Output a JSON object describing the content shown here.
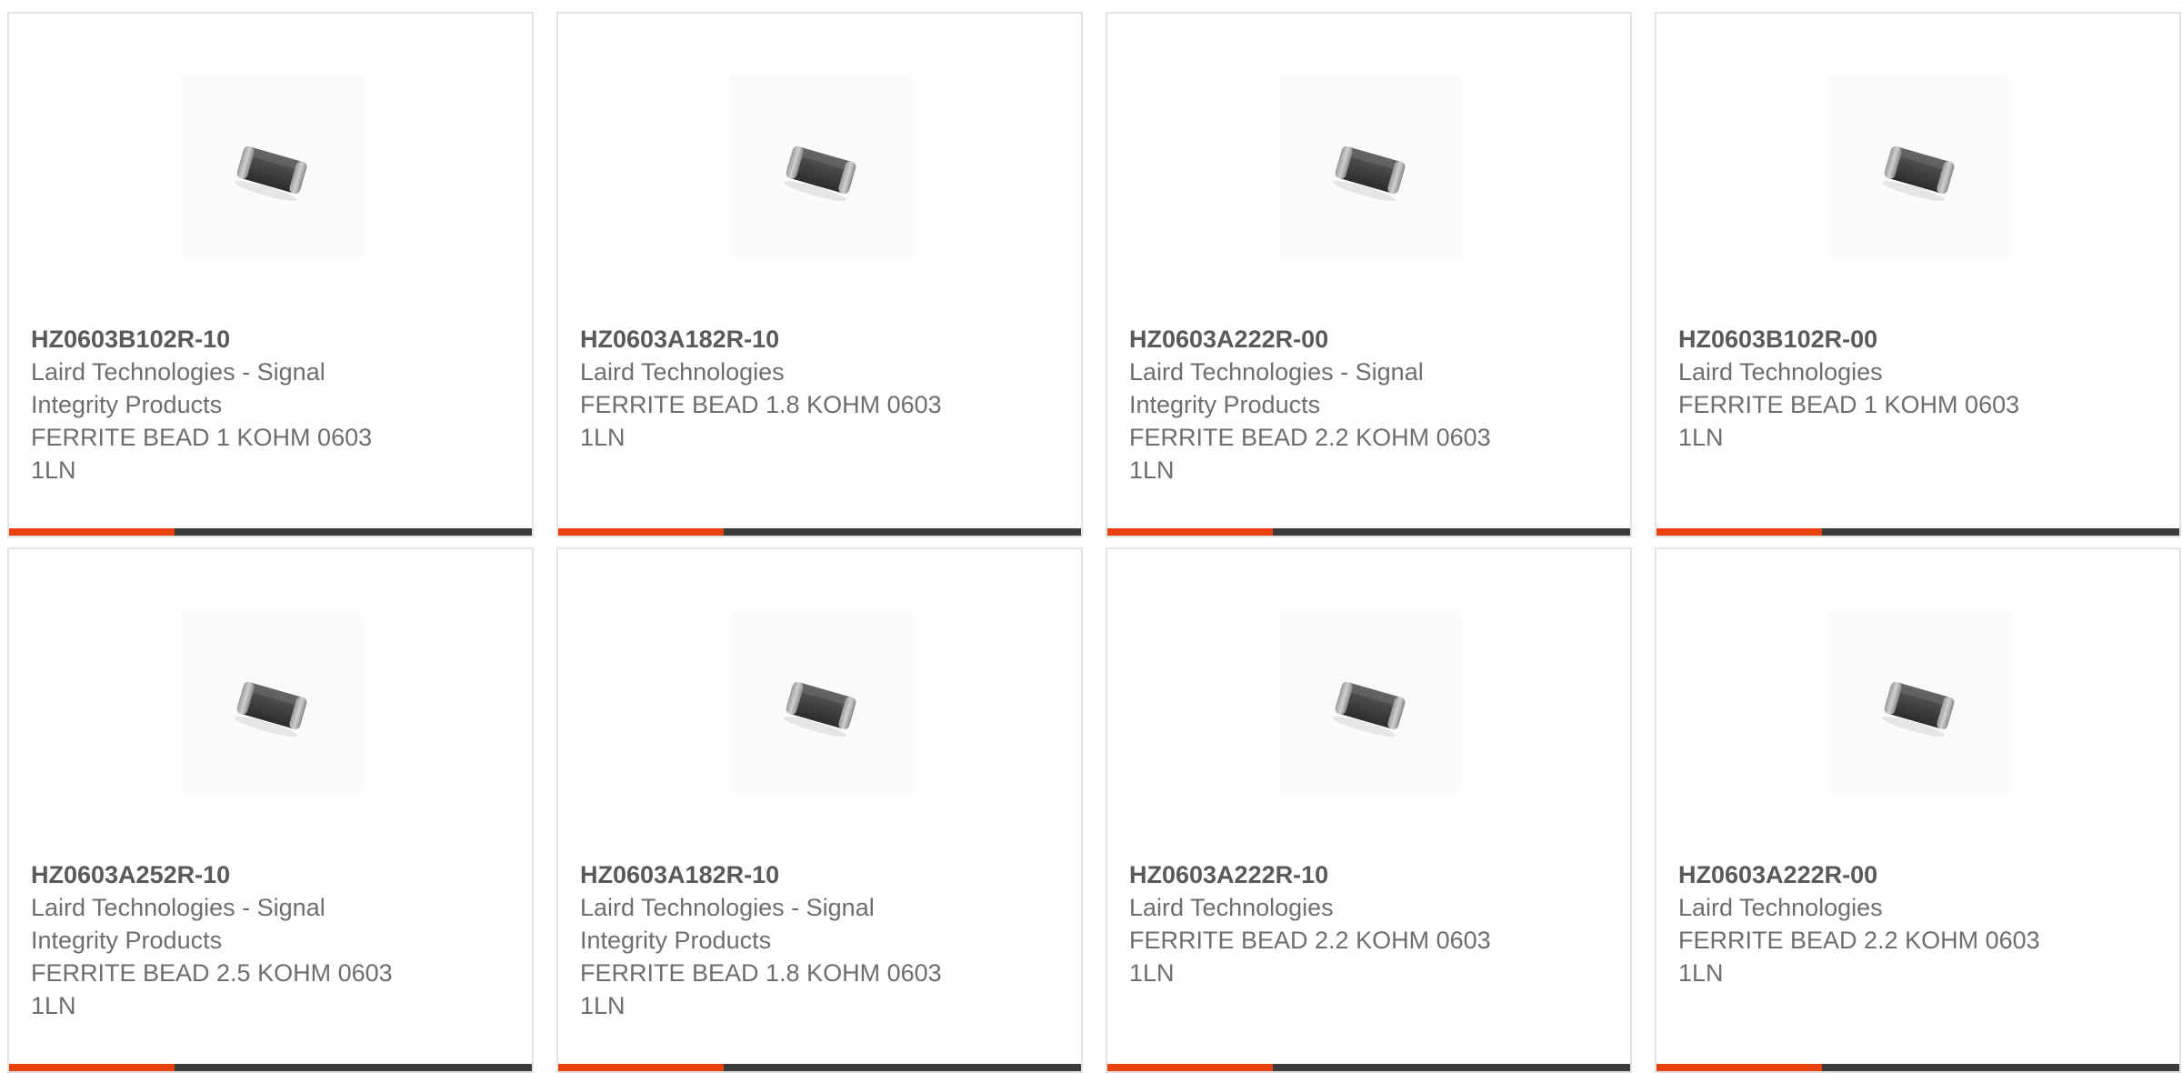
{
  "colors": {
    "accent": "#e8410a",
    "bar": "#3b3b3b",
    "card_border": "#e3e3e3",
    "text": "#6e6e6e"
  },
  "product_icon": "ferrite-bead-chip-icon",
  "products": [
    {
      "part_number": "HZ0603B102R-10",
      "manufacturer_line1": "Laird Technologies - Signal",
      "manufacturer_line2": "Integrity Products",
      "description_line1": "FERRITE BEAD 1 KOHM 0603",
      "description_line2": "1LN"
    },
    {
      "part_number": "HZ0603A182R-10",
      "manufacturer_line1": "Laird Technologies",
      "manufacturer_line2": "",
      "description_line1": "FERRITE BEAD 1.8 KOHM 0603",
      "description_line2": "1LN"
    },
    {
      "part_number": "HZ0603A222R-00",
      "manufacturer_line1": "Laird Technologies - Signal",
      "manufacturer_line2": "Integrity Products",
      "description_line1": "FERRITE BEAD 2.2 KOHM 0603",
      "description_line2": "1LN"
    },
    {
      "part_number": "HZ0603B102R-00",
      "manufacturer_line1": "Laird Technologies",
      "manufacturer_line2": "",
      "description_line1": "FERRITE BEAD 1 KOHM 0603",
      "description_line2": "1LN"
    },
    {
      "part_number": "HZ0603A252R-10",
      "manufacturer_line1": "Laird Technologies - Signal",
      "manufacturer_line2": "Integrity Products",
      "description_line1": "FERRITE BEAD 2.5 KOHM 0603",
      "description_line2": "1LN"
    },
    {
      "part_number": "HZ0603A182R-10",
      "manufacturer_line1": "Laird Technologies - Signal",
      "manufacturer_line2": "Integrity Products",
      "description_line1": "FERRITE BEAD 1.8 KOHM 0603",
      "description_line2": "1LN"
    },
    {
      "part_number": "HZ0603A222R-10",
      "manufacturer_line1": "Laird Technologies",
      "manufacturer_line2": "",
      "description_line1": "FERRITE BEAD 2.2 KOHM 0603",
      "description_line2": "1LN"
    },
    {
      "part_number": "HZ0603A222R-00",
      "manufacturer_line1": "Laird Technologies",
      "manufacturer_line2": "",
      "description_line1": "FERRITE BEAD 2.2 KOHM 0603",
      "description_line2": "1LN"
    }
  ]
}
